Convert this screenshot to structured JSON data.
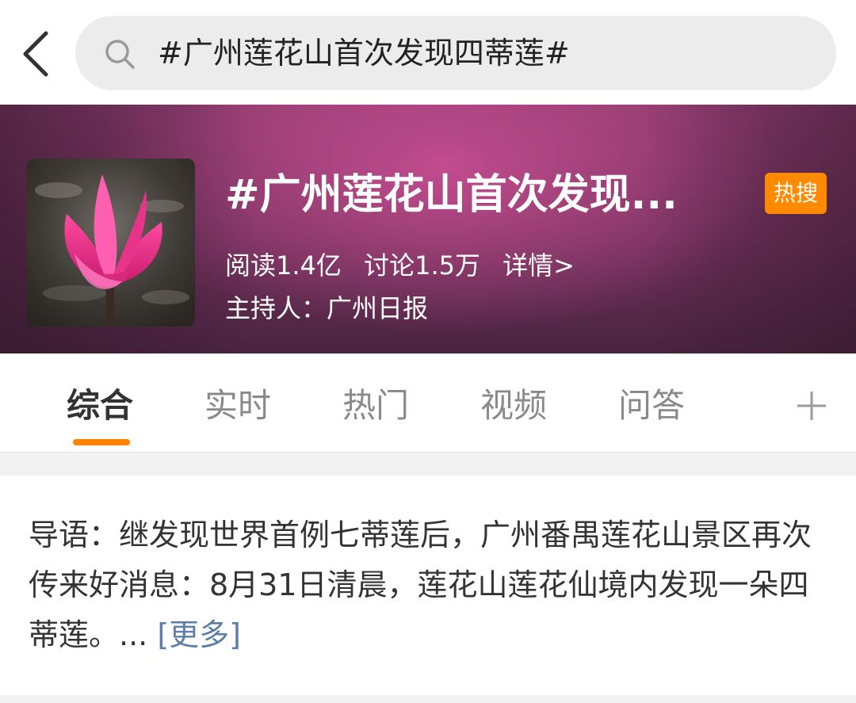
{
  "search": {
    "query": "#广州莲花山首次发现四蒂莲#"
  },
  "topic": {
    "title": "#广州莲花山首次发现...",
    "badge": "热搜",
    "reads": "阅读1.4亿",
    "discussions": "讨论1.5万",
    "details": "详情>",
    "host": "主持人：广州日报"
  },
  "tabs": [
    {
      "label": "综合",
      "active": true
    },
    {
      "label": "实时",
      "active": false
    },
    {
      "label": "热门",
      "active": false
    },
    {
      "label": "视频",
      "active": false
    },
    {
      "label": "问答",
      "active": false
    }
  ],
  "intro": {
    "text": "导语：继发现世界首例七蒂莲后，广州番禺莲花山景区再次传来好消息：8月31日清晨，莲花山莲花仙境内发现一朵四蒂莲。... ",
    "more": "[更多]"
  },
  "colors": {
    "accent": "#ff8200",
    "badge": "#ff8a00",
    "link": "#5b7fa8"
  },
  "icons": [
    "back-arrow-icon",
    "search-icon",
    "plus-icon"
  ]
}
